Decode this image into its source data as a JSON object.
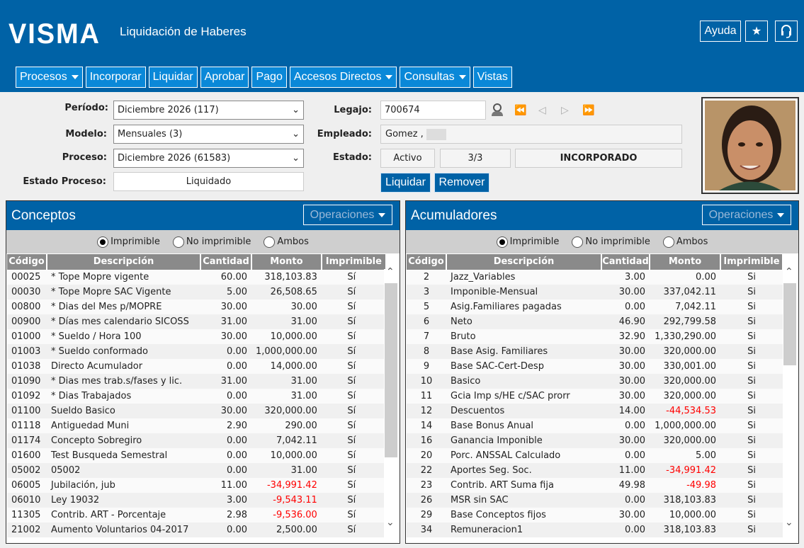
{
  "header": {
    "logo": "VISMA",
    "title": "Liquidación de Haberes",
    "help": "Ayuda",
    "icons": [
      "star-icon",
      "headset-icon"
    ]
  },
  "nav": [
    {
      "label": "Procesos",
      "dropdown": true
    },
    {
      "label": "Incorporar"
    },
    {
      "label": "Liquidar"
    },
    {
      "label": "Aprobar"
    },
    {
      "label": "Pago"
    },
    {
      "label": "Accesos Directos",
      "dropdown": true
    },
    {
      "label": "Consultas",
      "dropdown": true
    },
    {
      "label": "Vistas"
    }
  ],
  "form": {
    "periodo_label": "Período:",
    "periodo": "Diciembre 2026 (117)",
    "modelo_label": "Modelo:",
    "modelo": "Mensuales (3)",
    "proceso_label": "Proceso:",
    "proceso": "Diciembre 2026 (61583)",
    "estado_proceso_label": "Estado Proceso:",
    "estado_proceso": "Liquidado",
    "legajo_label": "Legajo:",
    "legajo": "700674",
    "empleado_label": "Empleado:",
    "empleado": "Gomez ,",
    "estado_label": "Estado:",
    "estado": "Activo",
    "fraccion": "3/3",
    "estado_liq": "INCORPORADO",
    "liquidar": "Liquidar",
    "remover": "Remover"
  },
  "colors": {
    "brand": "#0062a6",
    "nav": "#0a88d8",
    "negative": "#ff0000"
  },
  "radios": [
    "Imprimible",
    "No imprimible",
    "Ambos"
  ],
  "columns": [
    "Código",
    "Descripción",
    "Cantidad",
    "Monto",
    "Imprimible"
  ],
  "conceptos": {
    "title": "Conceptos",
    "operations": "Operaciones",
    "selected_radio": 0,
    "rows": [
      [
        "00025",
        "* Tope Mopre vigente",
        "60.00",
        "318,103.83",
        "Sí"
      ],
      [
        "00030",
        "* Tope Mopre SAC Vigente",
        "5.00",
        "26,508.65",
        "Sí"
      ],
      [
        "00800",
        "* Dias del Mes p/MOPRE",
        "30.00",
        "30.00",
        "Sí"
      ],
      [
        "00900",
        "* Días mes calendario SICOSS",
        "31.00",
        "31.00",
        "Sí"
      ],
      [
        "01000",
        "* Sueldo / Hora 100",
        "30.00",
        "10,000.00",
        "Sí"
      ],
      [
        "01003",
        "* Sueldo conformado",
        "0.00",
        "1,000,000.00",
        "Sí"
      ],
      [
        "01038",
        "Directo Acumulador",
        "0.00",
        "14,000.00",
        "Sí"
      ],
      [
        "01090",
        "* Dias mes trab.s/fases y lic.",
        "31.00",
        "31.00",
        "Sí"
      ],
      [
        "01092",
        "* Dias Trabajados",
        "0.00",
        "31.00",
        "Sí"
      ],
      [
        "01100",
        "Sueldo Basico",
        "30.00",
        "320,000.00",
        "Sí"
      ],
      [
        "01118",
        "Antiguedad Muni",
        "2.90",
        "290.00",
        "Sí"
      ],
      [
        "01174",
        "Concepto Sobregiro",
        "0.00",
        "7,042.11",
        "Sí"
      ],
      [
        "01600",
        "Test Busqueda Semestral",
        "0.00",
        "10,000.00",
        "Sí"
      ],
      [
        "05002",
        "05002",
        "0.00",
        "31.00",
        "Sí"
      ],
      [
        "06005",
        "Jubilación, jub",
        "11.00",
        "-34,991.42",
        "Sí"
      ],
      [
        "06010",
        "Ley 19032",
        "3.00",
        "-9,543.11",
        "Sí"
      ],
      [
        "11305",
        "Contrib. ART - Porcentaje",
        "2.98",
        "-9,536.00",
        "Sí"
      ],
      [
        "21002",
        "Aumento Voluntarios 04-2017",
        "0.00",
        "2,500.00",
        "Sí"
      ]
    ]
  },
  "acumuladores": {
    "title": "Acumuladores",
    "operations": "Operaciones",
    "selected_radio": 0,
    "rows": [
      [
        "2",
        "Jazz_Variables",
        "3.00",
        "0.00",
        "Si"
      ],
      [
        "3",
        "Imponible-Mensual",
        "30.00",
        "337,042.11",
        "Si"
      ],
      [
        "5",
        "Asig.Familiares pagadas",
        "0.00",
        "7,042.11",
        "Si"
      ],
      [
        "6",
        "Neto",
        "46.90",
        "292,799.58",
        "Si"
      ],
      [
        "7",
        "Bruto",
        "32.90",
        "1,330,290.00",
        "Si"
      ],
      [
        "8",
        "Base Asig. Familiares",
        "30.00",
        "320,000.00",
        "Si"
      ],
      [
        "9",
        "Base SAC-Cert-Desp",
        "30.00",
        "330,001.00",
        "Si"
      ],
      [
        "10",
        "Basico",
        "30.00",
        "320,000.00",
        "Si"
      ],
      [
        "11",
        "Gcia Imp s/HE c/SAC prorr",
        "30.00",
        "320,000.00",
        "Si"
      ],
      [
        "12",
        "Descuentos",
        "14.00",
        "-44,534.53",
        "Si"
      ],
      [
        "14",
        "Base Bonus Anual",
        "0.00",
        "1,000,000.00",
        "Si"
      ],
      [
        "16",
        "Ganancia Imponible",
        "30.00",
        "320,000.00",
        "Si"
      ],
      [
        "20",
        "Porc. ANSSAL Calculado",
        "0.00",
        "5.00",
        "Si"
      ],
      [
        "22",
        "Aportes Seg. Soc.",
        "11.00",
        "-34,991.42",
        "Si"
      ],
      [
        "23",
        "Contrib. ART Suma fija",
        "49.98",
        "-49.98",
        "Si"
      ],
      [
        "26",
        "MSR sin SAC",
        "0.00",
        "318,103.83",
        "Si"
      ],
      [
        "29",
        "Base Conceptos fijos",
        "30.00",
        "10,000.00",
        "Si"
      ],
      [
        "34",
        "Remuneracion1",
        "0.00",
        "318,103.83",
        "Si"
      ]
    ]
  }
}
